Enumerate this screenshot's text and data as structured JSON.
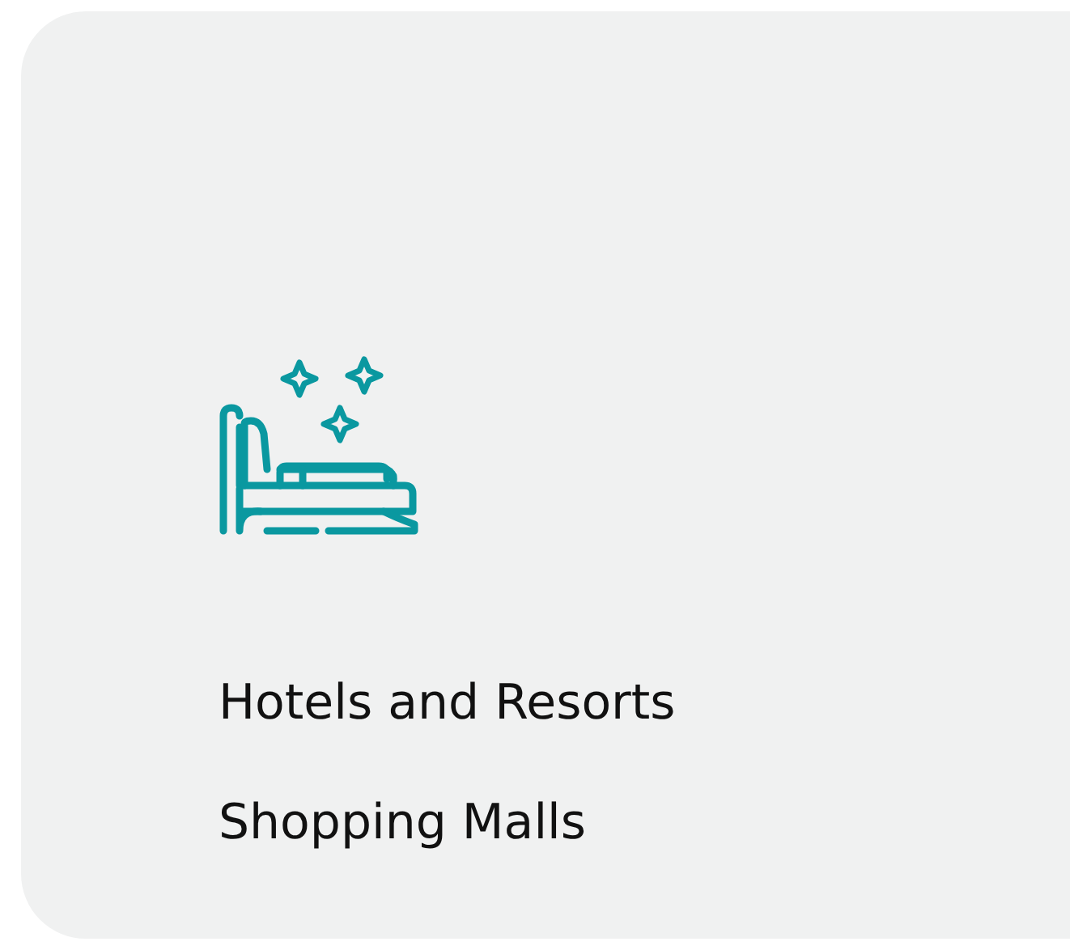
{
  "items": [
    {
      "label": "Hotels and Resorts"
    },
    {
      "label": "Shopping Malls"
    }
  ]
}
